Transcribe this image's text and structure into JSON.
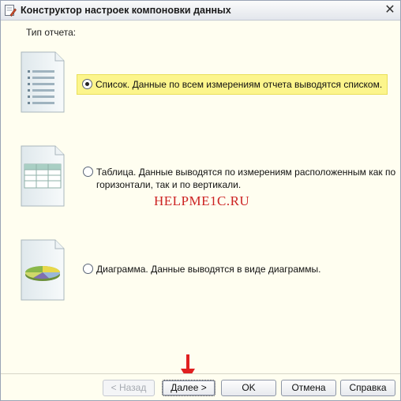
{
  "window": {
    "title": "Конструктор настроек компоновки данных"
  },
  "content": {
    "report_type_label": "Тип отчета:",
    "options": [
      {
        "icon": "list-document-icon",
        "text": "Список. Данные по всем измерениям отчета выводятся списком.",
        "selected": true
      },
      {
        "icon": "table-document-icon",
        "text": "Таблица. Данные выводятся по измерениям расположенным как по\nгоризонтали, так и по вертикали.",
        "selected": false
      },
      {
        "icon": "chart-document-icon",
        "text": "Диаграмма. Данные выводятся в виде диаграммы.",
        "selected": false
      }
    ],
    "watermark": "HELPME1C.RU"
  },
  "footer": {
    "back_label": "< Назад",
    "next_label": "Далее >",
    "ok_label": "OK",
    "cancel_label": "Отмена",
    "help_label": "Справка"
  },
  "colors": {
    "selection_highlight": "#fcf58c",
    "arrow": "#e02020",
    "watermark": "#cc2222"
  }
}
